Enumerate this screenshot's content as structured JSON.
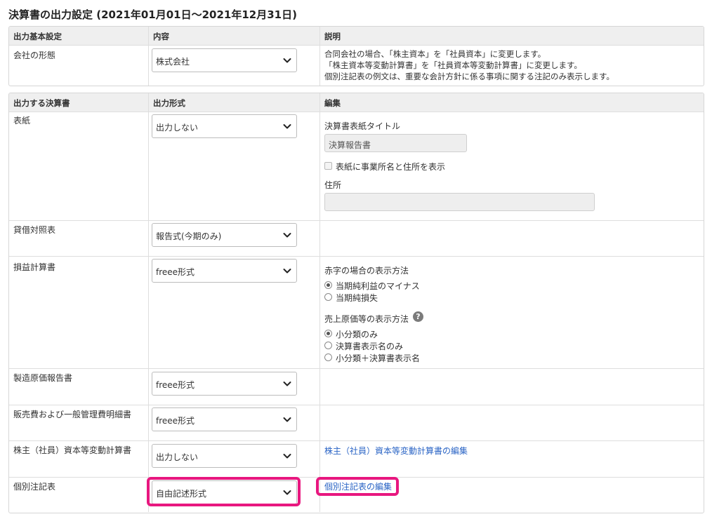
{
  "page": {
    "title": "決算書の出力設定 (2021年01月01日〜2021年12月31日)"
  },
  "basic_table": {
    "headers": [
      "出力基本設定",
      "内容",
      "説明"
    ],
    "row": {
      "label": "会社の形態",
      "select_value": "株式会社",
      "description": [
        "合同会社の場合、「株主資本」を「社員資本」に変更します。",
        "「株主資本等変動計算書」を「社員資本等変動計算書」に変更します。",
        "個別注記表の例文は、重要な会計方針に係る事項に関する注記のみ表示します。"
      ]
    }
  },
  "statements_table": {
    "headers": [
      "出力する決算書",
      "出力形式",
      "編集"
    ],
    "rows": [
      {
        "label": "表紙",
        "select_value": "出力しない"
      },
      {
        "label": "貸借対照表",
        "select_value": "報告式(今期のみ)"
      },
      {
        "label": "損益計算書",
        "select_value": "freee形式"
      },
      {
        "label": "製造原価報告書",
        "select_value": "freee形式"
      },
      {
        "label": "販売費および一般管理費明細書",
        "select_value": "freee形式"
      },
      {
        "label": "株主（社員）資本等変動計算書",
        "select_value": "出力しない"
      },
      {
        "label": "個別注記表",
        "select_value": "自由記述形式"
      }
    ]
  },
  "cover_edit": {
    "title_label": "決算書表紙タイトル",
    "title_value": "決算報告書",
    "checkbox_label": "表紙に事業所名と住所を表示",
    "checkbox_checked": false,
    "address_label": "住所",
    "address_value": ""
  },
  "pl_edit": {
    "loss_label": "赤字の場合の表示方法",
    "loss_options": [
      "当期純利益のマイナス",
      "当期純損失"
    ],
    "loss_selected": 0,
    "cogs_label": "売上原価等の表示方法",
    "cogs_options": [
      "小分類のみ",
      "決算書表示名のみ",
      "小分類＋決算書表示名"
    ],
    "cogs_selected": 0
  },
  "links": {
    "equity_edit": "株主（社員）資本等変動計算書の編集",
    "notes_edit": "個別注記表の編集"
  },
  "icons": {
    "help": "?"
  },
  "colors": {
    "highlight": "#e8177f",
    "link": "#2a64c5",
    "header_bg": "#efefef"
  }
}
